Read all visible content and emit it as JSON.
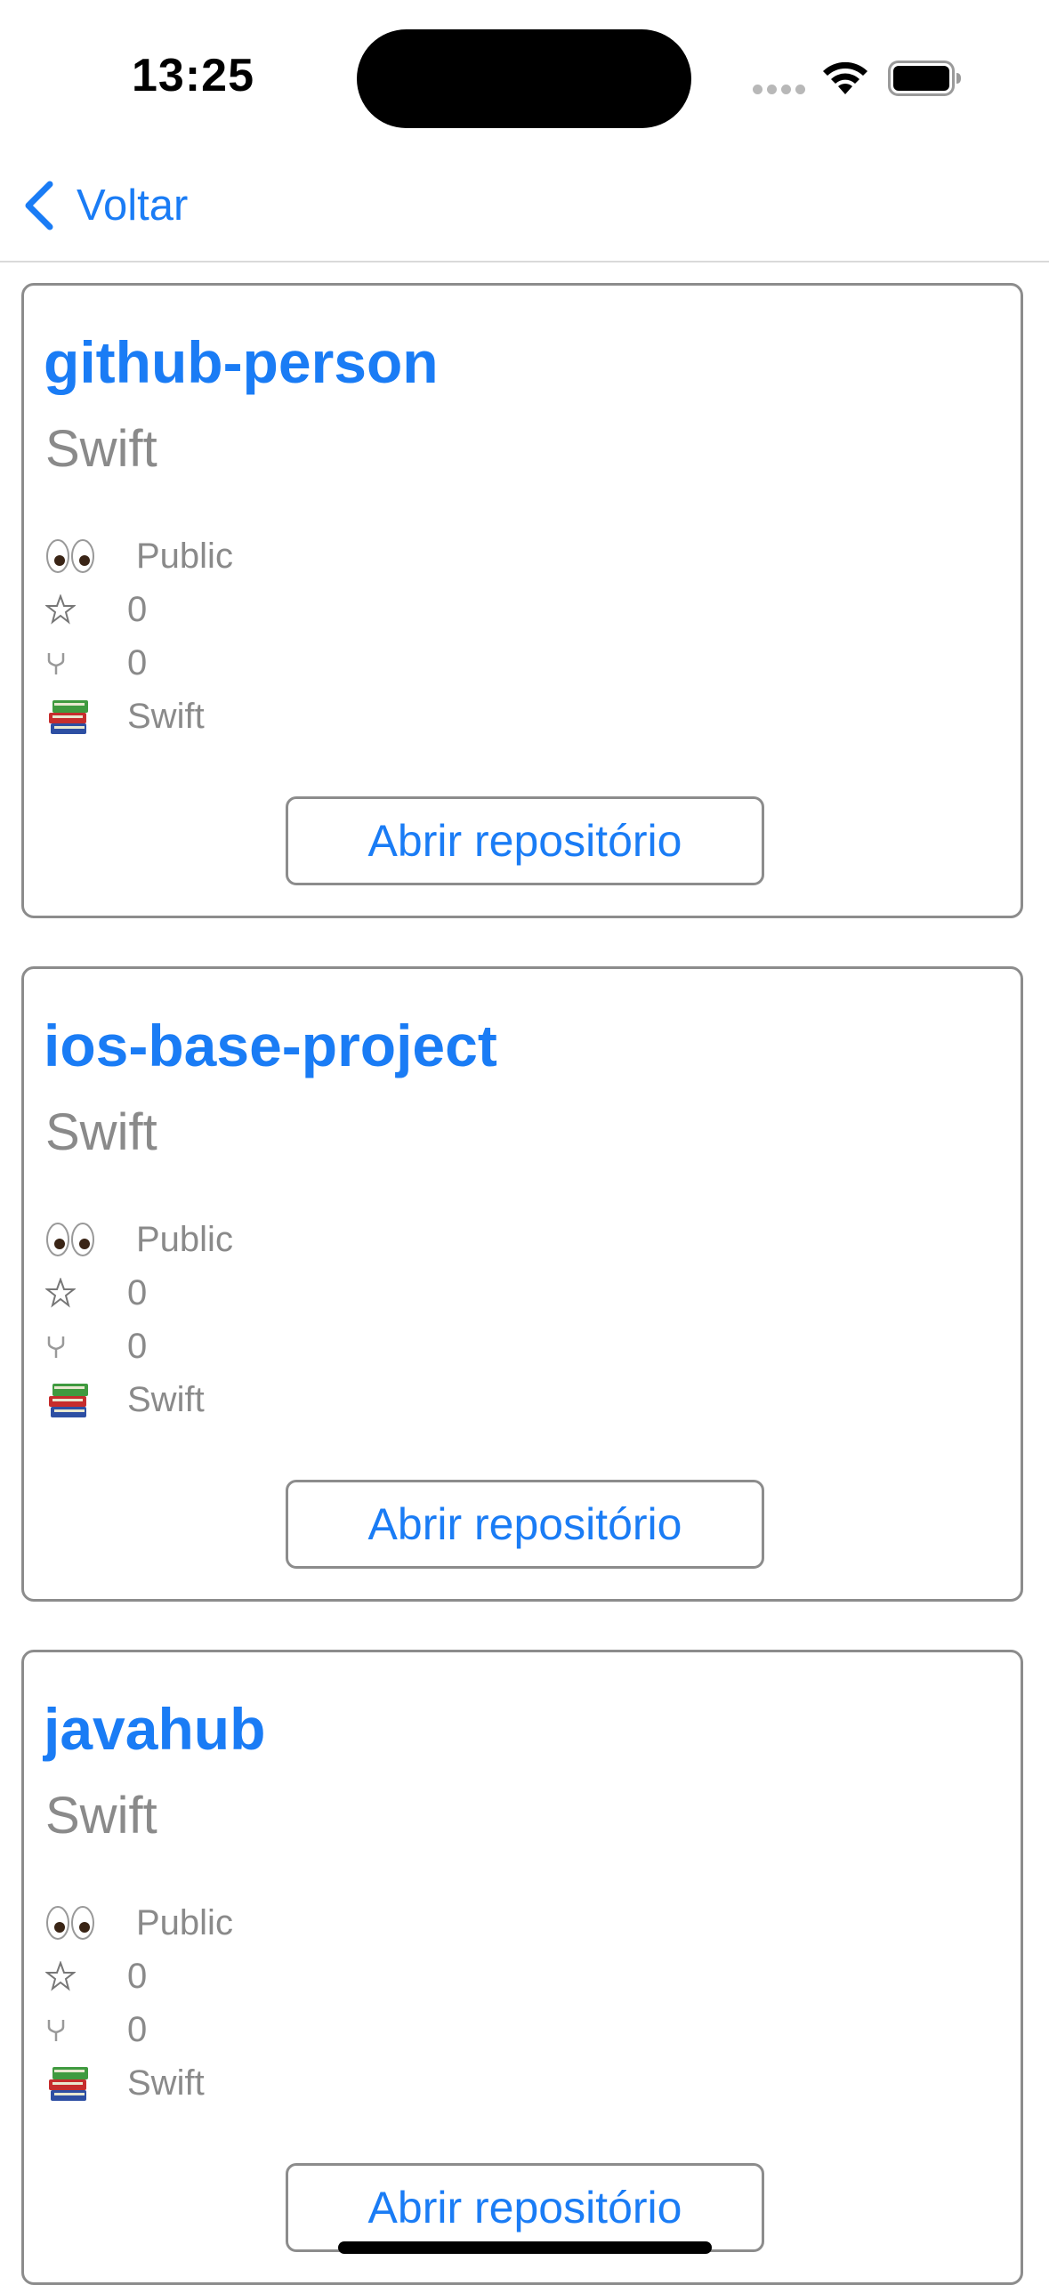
{
  "status_bar": {
    "time": "13:25",
    "icons": [
      "cellular-signal-icon",
      "wifi-icon",
      "battery-icon"
    ]
  },
  "nav": {
    "back_label": "Voltar",
    "back_icon": "chevron-left-icon"
  },
  "colors": {
    "accent": "#1a7cf5",
    "secondary_text": "#8a8a8a",
    "border": "#8c8c8c"
  },
  "repositories": [
    {
      "name": "github-person",
      "language": "Swift",
      "visibility": "Public",
      "stars": "0",
      "forks": "0",
      "language_detail": "Swift",
      "button_label": "Abrir repositório"
    },
    {
      "name": "ios-base-project",
      "language": "Swift",
      "visibility": "Public",
      "stars": "0",
      "forks": "0",
      "language_detail": "Swift",
      "button_label": "Abrir repositório"
    },
    {
      "name": "javahub",
      "language": "Swift",
      "visibility": "Public",
      "stars": "0",
      "forks": "0",
      "language_detail": "Swift",
      "button_label": "Abrir repositório"
    }
  ]
}
